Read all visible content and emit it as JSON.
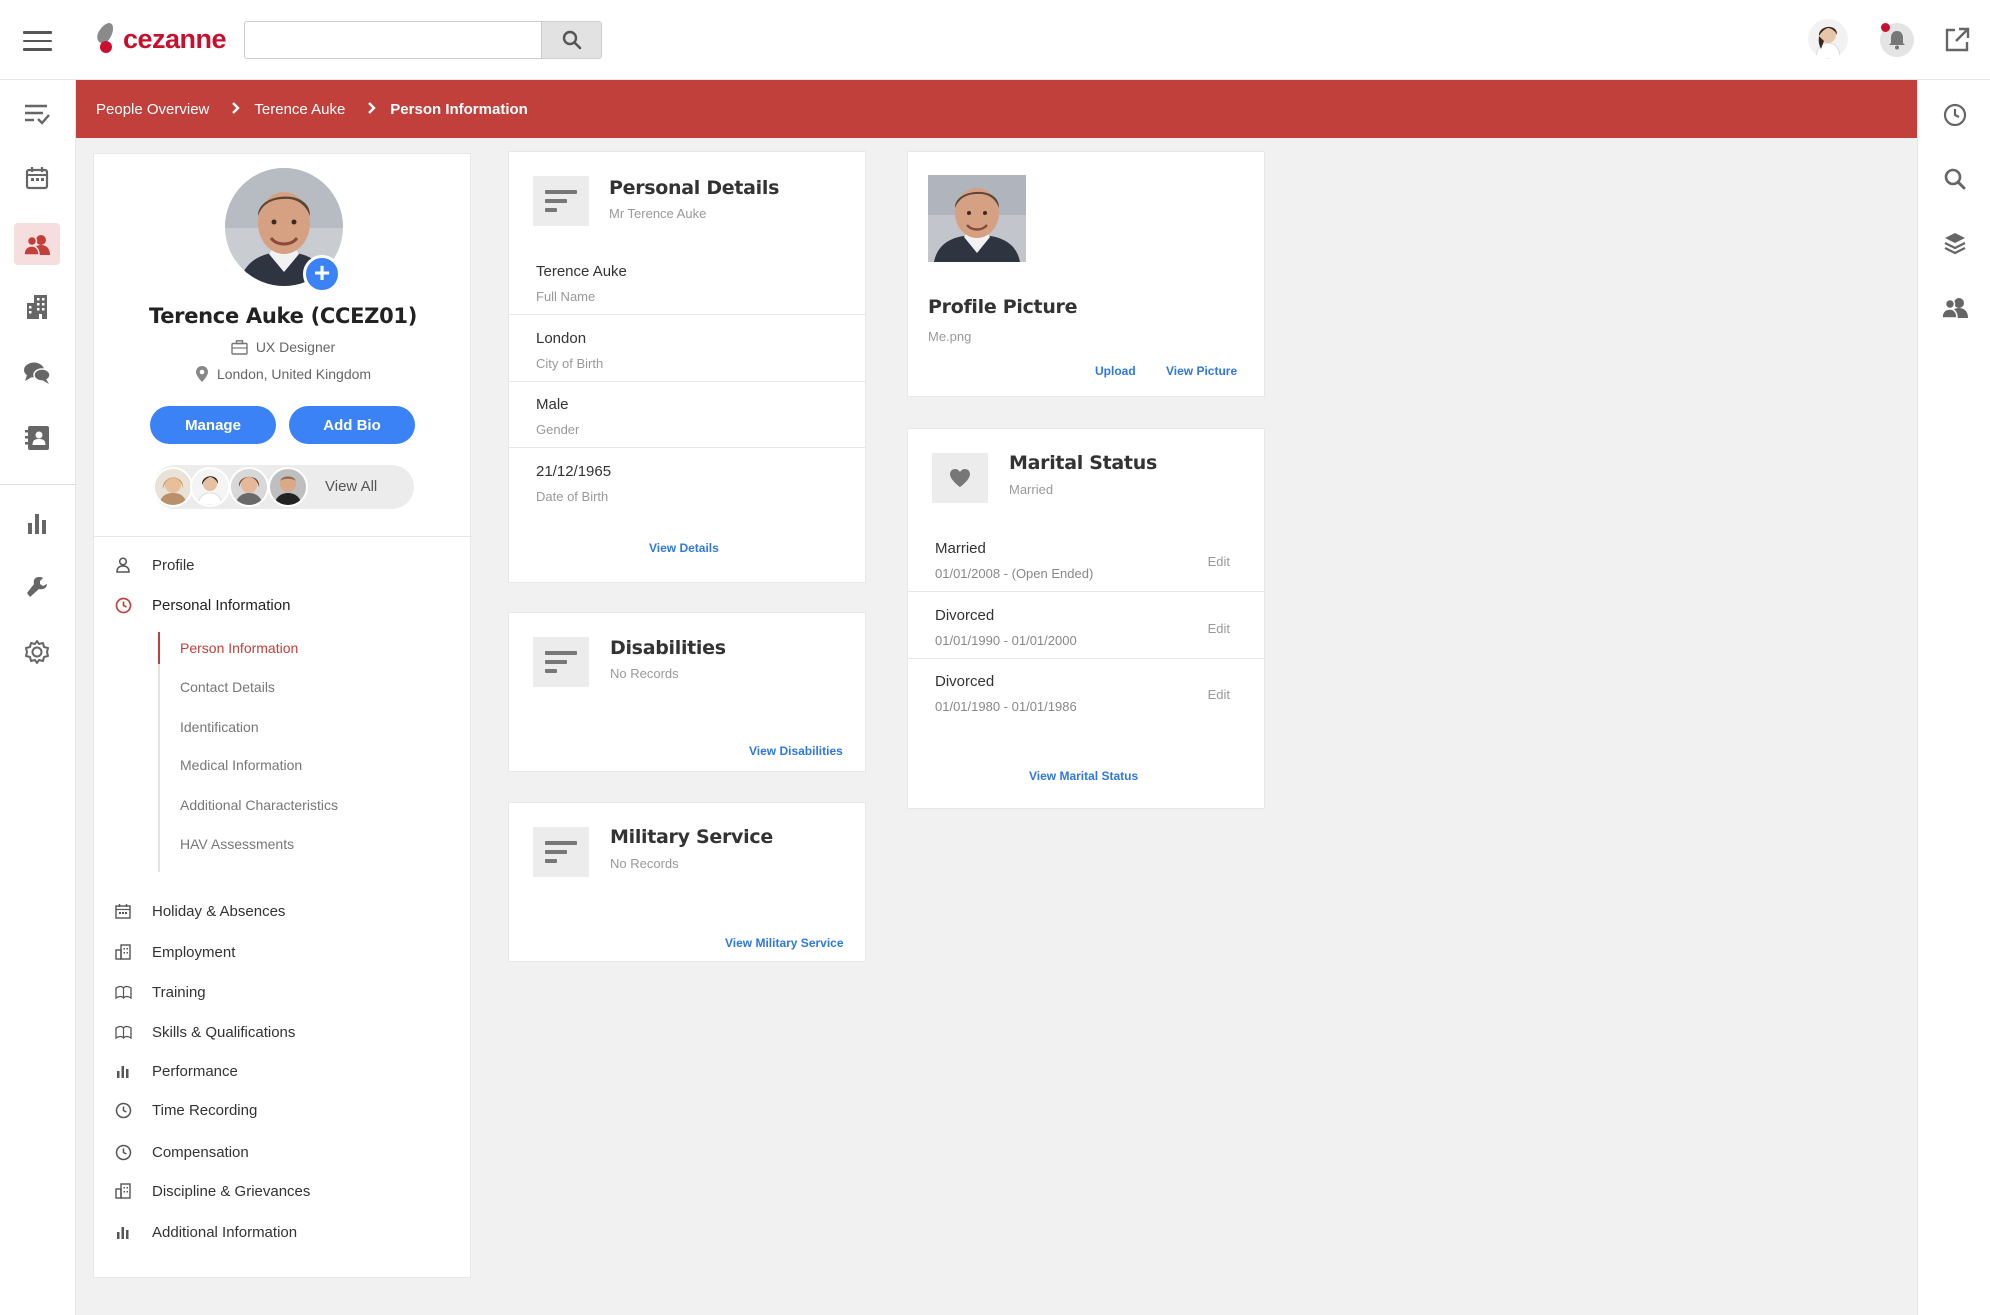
{
  "app": {
    "logo_text": "cezanne"
  },
  "search": {
    "placeholder": "",
    "value": ""
  },
  "breadcrumb": [
    "People Overview",
    "Terence Auke",
    "Person Information"
  ],
  "profile": {
    "name": "Terence Auke (CCEZ01)",
    "job_title": "UX Designer",
    "location": "London, United Kingdom",
    "manage_label": "Manage",
    "add_bio_label": "Add Bio",
    "view_all_label": "View All"
  },
  "nav": [
    {
      "label": "Profile",
      "icon": "person-icon"
    },
    {
      "label": "Personal Information",
      "icon": "clock-icon"
    },
    {
      "label": "Holiday & Absences",
      "icon": "calendar-icon"
    },
    {
      "label": "Employment",
      "icon": "building-icon"
    },
    {
      "label": "Training",
      "icon": "book-icon"
    },
    {
      "label": "Skills & Qualifications",
      "icon": "book-icon"
    },
    {
      "label": "Performance",
      "icon": "chart-icon"
    },
    {
      "label": "Time Recording",
      "icon": "clock-icon"
    },
    {
      "label": "Compensation",
      "icon": "clock-icon"
    },
    {
      "label": "Discipline & Grievances",
      "icon": "building-icon"
    },
    {
      "label": "Additional Information",
      "icon": "chart-icon"
    }
  ],
  "subnav": [
    "Person Information",
    "Contact Details",
    "Identification",
    "Medical Information",
    "Additional Characteristics",
    "HAV Assessments"
  ],
  "personal_details": {
    "title": "Personal Details",
    "subtitle": "Mr Terence Auke",
    "rows": [
      {
        "value": "Terence Auke",
        "label": "Full Name"
      },
      {
        "value": "London",
        "label": "City of Birth"
      },
      {
        "value": "Male",
        "label": "Gender"
      },
      {
        "value": "21/12/1965",
        "label": "Date of Birth"
      }
    ],
    "link": "View Details"
  },
  "disabilities": {
    "title": "Disabilities",
    "subtitle": "No Records",
    "link": "View Disabilities"
  },
  "military": {
    "title": "Military Service",
    "subtitle": "No Records",
    "link": "View Military Service"
  },
  "profile_picture": {
    "title": "Profile Picture",
    "filename": "Me.png",
    "upload_label": "Upload",
    "view_label": "View Picture"
  },
  "marital": {
    "title": "Marital Status",
    "subtitle": "Married",
    "rows": [
      {
        "status": "Married",
        "dates": "01/01/2008 - (Open Ended)",
        "edit": "Edit"
      },
      {
        "status": "Divorced",
        "dates": "01/01/1990 - 01/01/2000",
        "edit": "Edit"
      },
      {
        "status": "Divorced",
        "dates": "01/01/1980 - 01/01/1986",
        "edit": "Edit"
      }
    ],
    "link": "View Marital Status"
  },
  "colors": {
    "accent_red": "#c2403c",
    "brand_red": "#c8102e",
    "button_blue": "#3b82f6",
    "link_blue": "#2f78e0"
  }
}
